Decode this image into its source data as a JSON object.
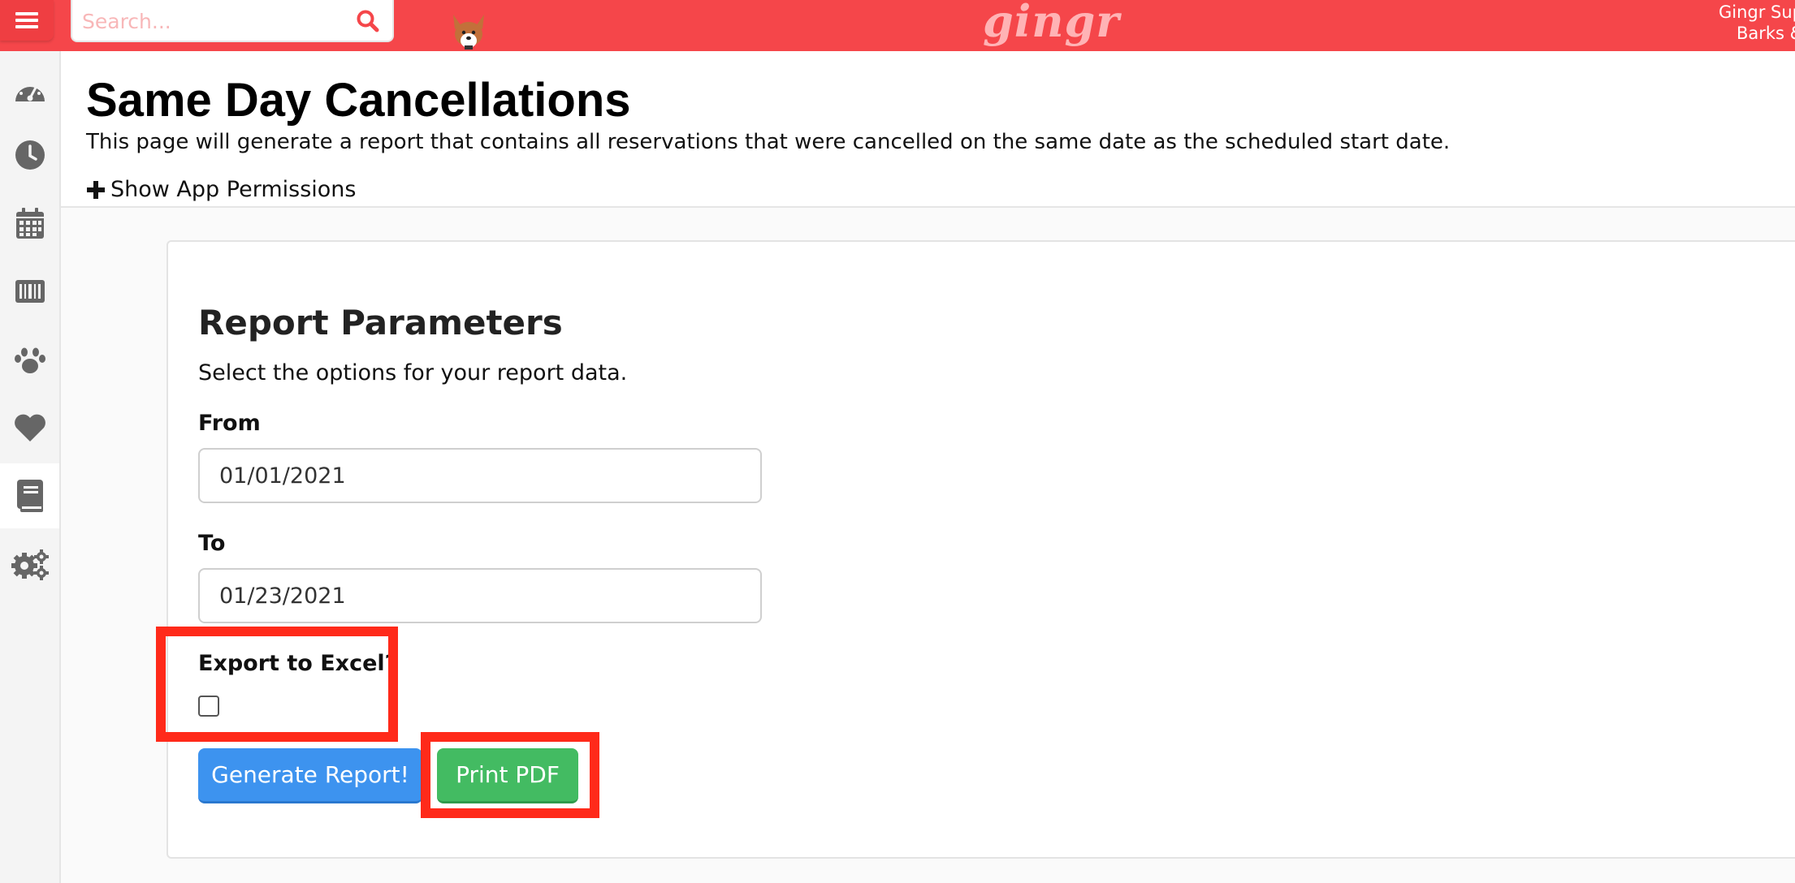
{
  "topbar": {
    "search_placeholder": "Search...",
    "brand": "gingr",
    "user_line1": "Gingr Sup",
    "user_line2": "Barks &"
  },
  "sidebar": {
    "items": [
      {
        "icon": "dashboard-icon"
      },
      {
        "icon": "clock-icon"
      },
      {
        "icon": "calendar-icon"
      },
      {
        "icon": "barcode-icon"
      },
      {
        "icon": "paw-icon"
      },
      {
        "icon": "heart-icon"
      },
      {
        "icon": "book-icon",
        "active": true
      },
      {
        "icon": "gears-icon"
      }
    ]
  },
  "page": {
    "title": "Same Day Cancellations",
    "description": "This page will generate a report that contains all reservations that were cancelled on the same date as the scheduled start date.",
    "permissions_toggle": "Show App Permissions"
  },
  "report": {
    "title": "Report Parameters",
    "subtitle": "Select the options for your report data.",
    "from_label": "From",
    "from_value": "01/01/2021",
    "to_label": "To",
    "to_value": "01/23/2021",
    "export_label": "Export to Excel?",
    "export_checked": false,
    "generate_label": "Generate Report!",
    "print_label": "Print PDF"
  },
  "colors": {
    "topbar": "#f5464a",
    "primary_button": "#3d93ef",
    "success_button": "#43bb62",
    "highlight": "#ff2a1a"
  }
}
